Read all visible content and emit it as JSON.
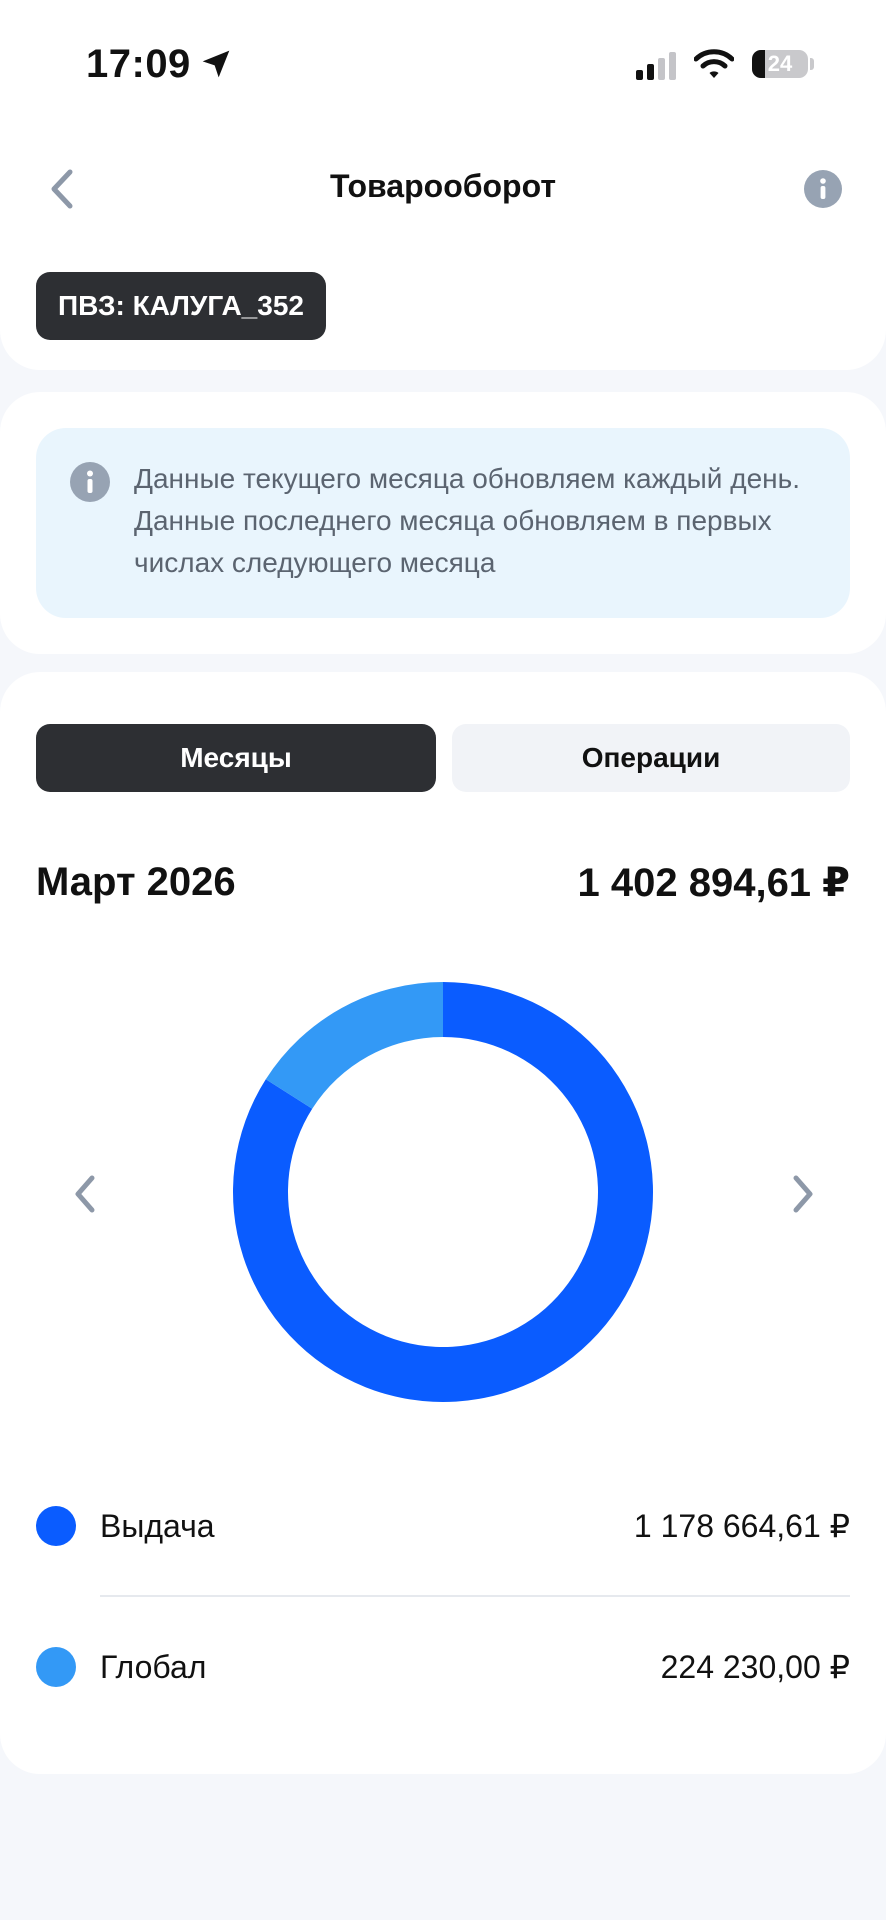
{
  "status_bar": {
    "time": "17:09",
    "battery": "24",
    "battery_level": 0.24
  },
  "header": {
    "title": "Товарооборот"
  },
  "pvz": {
    "label": "ПВЗ: КАЛУГА_352"
  },
  "notice": {
    "text": "Данные текущего месяца обновляем каждый день. Данные последнего месяца обновляем в первых числах следующего месяца"
  },
  "tabs": [
    {
      "label": "Месяцы",
      "active": true
    },
    {
      "label": "Операции",
      "active": false
    }
  ],
  "summary": {
    "month": "Март 2026",
    "total": "1 402 894,61 ₽"
  },
  "chart_data": {
    "type": "pie",
    "categories": [
      "Выдача",
      "Глобал"
    ],
    "values": [
      1178664.61,
      224230.0
    ],
    "colors": [
      "#0a5cff",
      "#3399f6"
    ]
  },
  "legend": [
    {
      "name": "Выдача",
      "value": "1 178 664,61 ₽",
      "color": "#0a5cff"
    },
    {
      "name": "Глобал",
      "value": "224 230,00 ₽",
      "color": "#3399f6"
    }
  ]
}
